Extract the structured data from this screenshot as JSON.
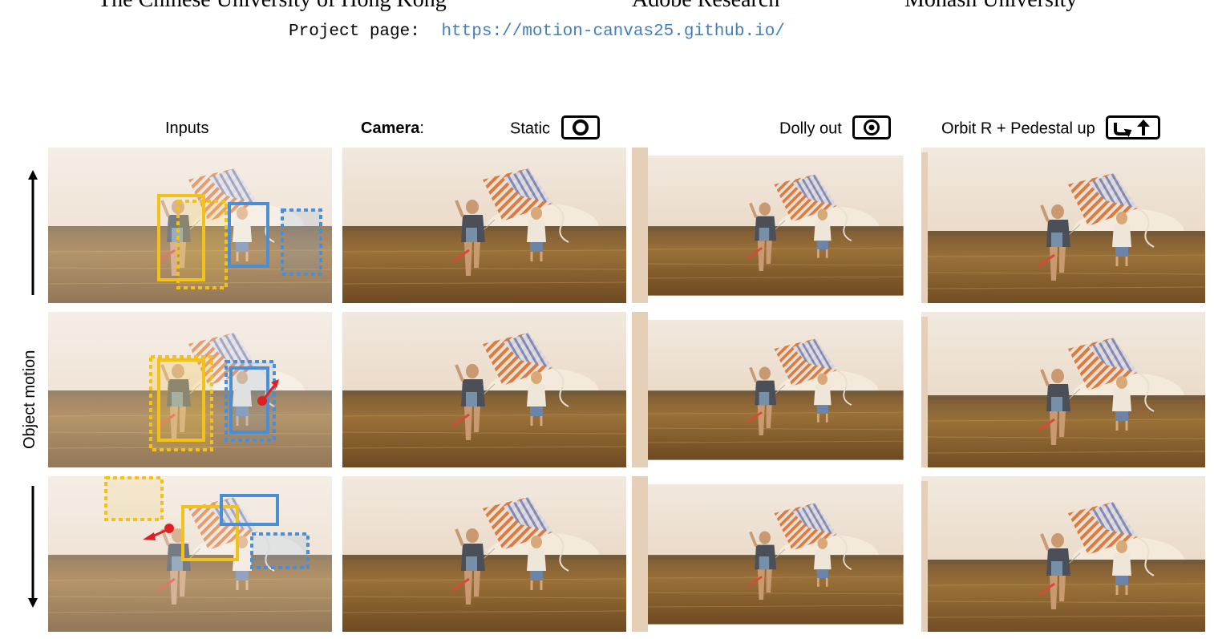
{
  "header": {
    "affiliations": [
      "The Chinese University of Hong Kong",
      "Adobe Research",
      "Monash University"
    ],
    "project_label": "Project page:",
    "project_url": "https://motion-canvas25.github.io/"
  },
  "figure": {
    "inputs_title": "Inputs",
    "camera_label": "Camera",
    "camera_colon": ":",
    "columns": [
      {
        "label": "Static",
        "icon": "static-camera-icon"
      },
      {
        "label": "Dolly out",
        "icon": "dolly-out-icon"
      },
      {
        "label": "Orbit R + Pedestal up",
        "icon": "orbit-pedestal-icon"
      }
    ],
    "side_label": "Object motion",
    "rows": [
      "object-motion-up",
      "object-motion-right",
      "object-motion-down"
    ],
    "colors": {
      "yellow_box": "#f2c11a",
      "blue_box": "#4a8fd6",
      "motion_arrow": "#e02020",
      "sky": "#e9dccb",
      "field": "#8a6230"
    }
  }
}
